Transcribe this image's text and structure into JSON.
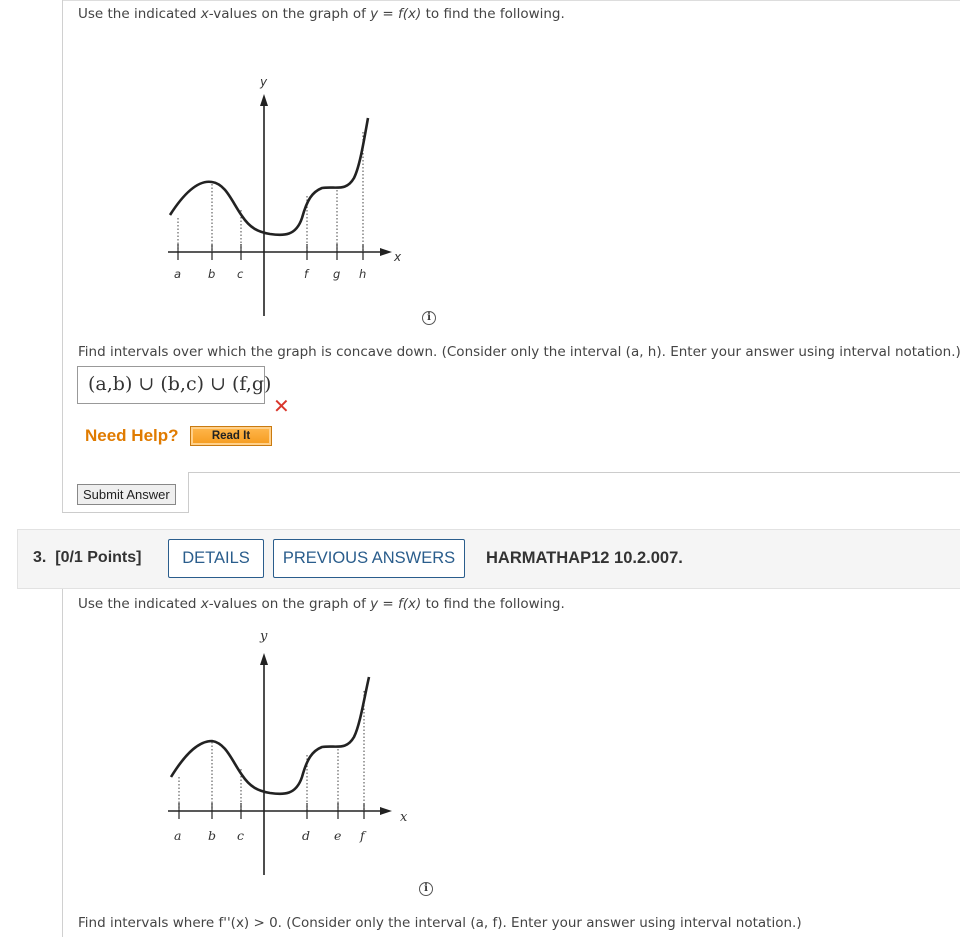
{
  "q2": {
    "prompt_pre": "Use the indicated ",
    "prompt_xvals": "x",
    "prompt_mid": "-values on the graph of ",
    "prompt_y": "y",
    "prompt_eq": " = ",
    "prompt_fx": "f(x)",
    "prompt_post": " to find the following.",
    "graph": {
      "y_axis_label": "y",
      "x_axis_label": "x",
      "tick_labels": [
        "a",
        "b",
        "c",
        "f",
        "g",
        "h"
      ]
    },
    "info_icon": "i",
    "question_text": "Find intervals over which the graph is concave down. (Consider only the interval (a, h). Enter your answer using interval notation.)",
    "answer_value": "(a,b) ∪ (b,c) ∪ (f,g)",
    "result_icon": "wrong-x",
    "need_help_label": "Need Help?",
    "read_it_label": "Read It",
    "submit_label": "Submit Answer"
  },
  "q3": {
    "number_label": "3.",
    "points_label": "[0/1 Points]",
    "details_label": "DETAILS",
    "previous_answers_label": "PREVIOUS ANSWERS",
    "code_label": "HARMATHAP12 10.2.007.",
    "prompt_pre": "Use the indicated ",
    "prompt_xvals": "x",
    "prompt_mid": "-values on the graph of ",
    "prompt_y": "y",
    "prompt_eq": " = ",
    "prompt_fx": "f(x)",
    "prompt_post": " to find the following.",
    "graph": {
      "y_axis_label": "y",
      "x_axis_label": "x",
      "tick_labels": [
        "a",
        "b",
        "c",
        "d",
        "e",
        "f"
      ]
    },
    "info_icon": "i",
    "question_text": "Find intervals where f''(x) > 0. (Consider only the interval (a, f). Enter your answer using interval notation.)"
  },
  "colors": {
    "accent_blue": "#2a5d8c",
    "need_help_orange": "#e07b00",
    "wrong_red": "#d9362b"
  }
}
